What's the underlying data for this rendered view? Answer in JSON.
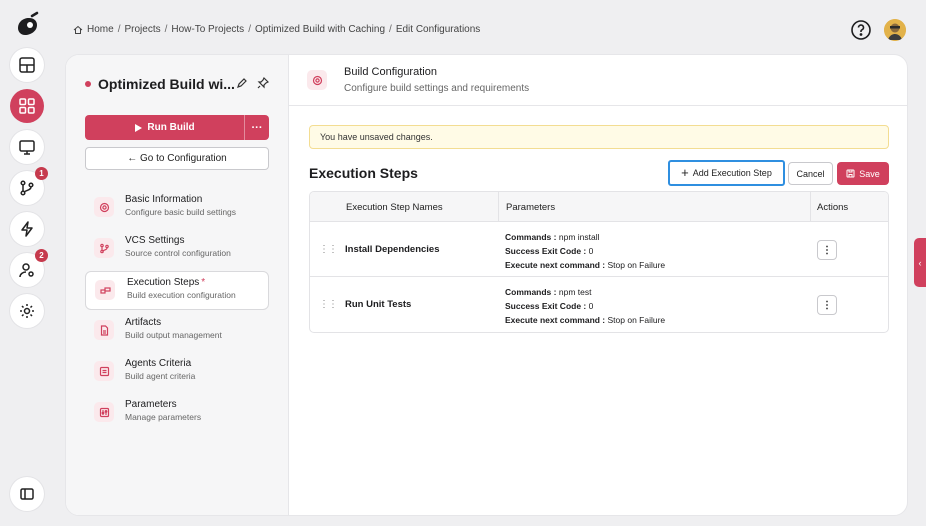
{
  "breadcrumb": [
    {
      "label": "Home"
    },
    {
      "label": "Projects"
    },
    {
      "label": "How-To Projects"
    },
    {
      "label": "Optimized Build with Caching"
    },
    {
      "label": "Edit Configurations"
    }
  ],
  "rail": {
    "badges": {
      "vcs": "1",
      "users": "2"
    }
  },
  "build": {
    "title": "Optimized Build wi...",
    "run_label": "Run Build",
    "run_more": "···",
    "goto_label": "← Go to Configuration"
  },
  "nav": [
    {
      "label": "Basic Information",
      "sub": "Configure basic build settings",
      "icon": "gear-icon"
    },
    {
      "label": "VCS Settings",
      "sub": "Source control configuration",
      "icon": "branch-icon"
    },
    {
      "label": "Execution Steps",
      "sub": "Build execution configuration",
      "icon": "steps-icon",
      "required": "*"
    },
    {
      "label": "Artifacts",
      "sub": "Build output management",
      "icon": "file-icon"
    },
    {
      "label": "Agents Criteria",
      "sub": "Build agent criteria",
      "icon": "agent-icon"
    },
    {
      "label": "Parameters",
      "sub": "Manage parameters",
      "icon": "sliders-icon"
    }
  ],
  "section": {
    "title": "Build Configuration",
    "subtitle": "Configure build settings and requirements"
  },
  "alert": "You have unsaved changes.",
  "execution": {
    "title": "Execution Steps",
    "add_label": "Add Execution Step",
    "cancel_label": "Cancel",
    "save_label": "Save",
    "columns": [
      "Execution Step Names",
      "Parameters",
      "Actions"
    ],
    "rows": [
      {
        "name": "Install Dependencies",
        "commands_label": "Commands :",
        "commands": "npm install",
        "exit_label": "Success Exit Code :",
        "exit": "0",
        "next_label": "Execute next command :",
        "next": "Stop on Failure"
      },
      {
        "name": "Run Unit Tests",
        "commands_label": "Commands :",
        "commands": "npm test",
        "exit_label": "Success Exit Code :",
        "exit": "0",
        "next_label": "Execute next command :",
        "next": "Stop on Failure"
      }
    ]
  },
  "colors": {
    "accent": "#d0405d",
    "focus": "#2f8fe0",
    "alert_bg": "#fffbe6"
  }
}
